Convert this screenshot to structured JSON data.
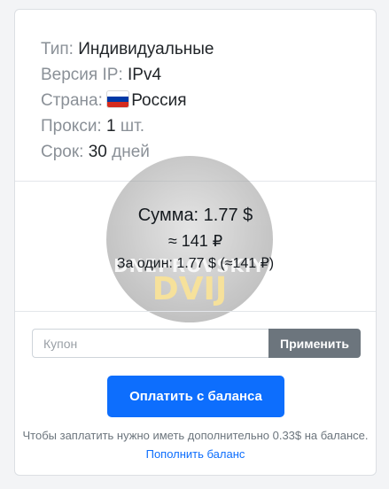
{
  "details": {
    "type_label": "Тип:",
    "type_value": "Индивидуальные",
    "ip_label": "Версия IP:",
    "ip_value": "IPv4",
    "country_label": "Страна:",
    "country_value": "Россия",
    "country_flag": "russia-flag-icon",
    "proxies_label": "Прокси:",
    "proxies_value": "1",
    "proxies_unit": "шт.",
    "term_label": "Срок:",
    "term_value": "30",
    "term_unit": "дней"
  },
  "watermark": {
    "line1": "DNEPROVSKIY",
    "line2": "DVIJ"
  },
  "summary": {
    "total": "Сумма: 1.77 $",
    "total_rub": "≈ 141 ₽",
    "per_one": "За один: 1.77 $ (≈141 ₽)"
  },
  "coupon": {
    "placeholder": "Купон",
    "value": "",
    "apply_label": "Применить"
  },
  "pay": {
    "label": "Оплатить с баланса"
  },
  "note": {
    "text": "Чтобы заплатить нужно иметь дополнительно 0.33$ на балансе.",
    "link_label": "Пополнить баланс"
  },
  "colors": {
    "primary": "#0d6efd",
    "secondary": "#6c757d",
    "flag_white": "#ffffff",
    "flag_blue": "#0039a6",
    "flag_red": "#d52b1e"
  }
}
